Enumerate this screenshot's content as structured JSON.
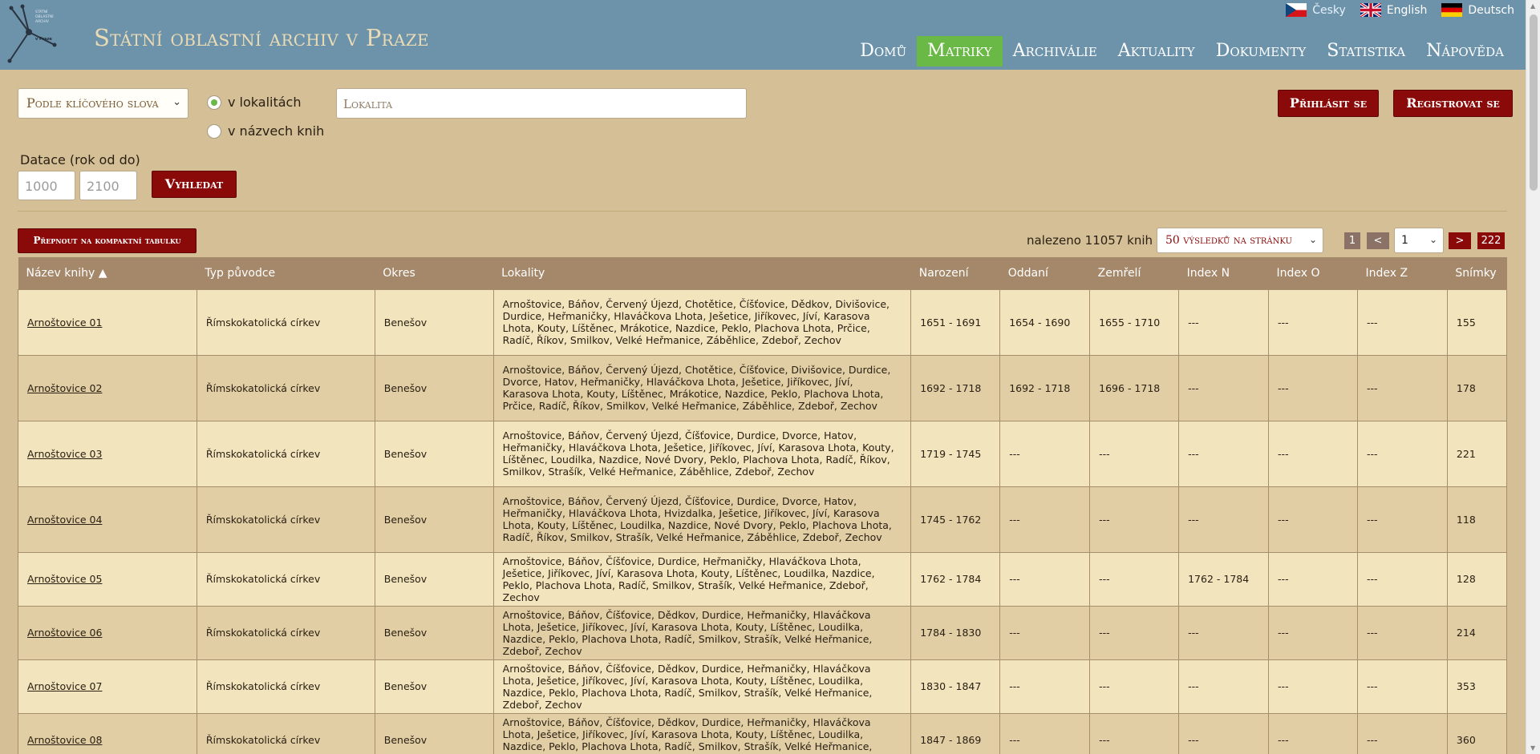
{
  "header": {
    "logo_text": [
      "STÁTNÍ",
      "OBLASTNÍ",
      "ARCHIV",
      "v Praze"
    ],
    "site_title": "Státní oblastní archiv v Praze",
    "languages": [
      {
        "label": "Česky",
        "flag": "cz-flag-icon"
      },
      {
        "label": "English",
        "flag": "uk-flag-icon"
      },
      {
        "label": "Deutsch",
        "flag": "de-flag-icon"
      }
    ],
    "nav": [
      "Domů",
      "Matriky",
      "Archiválie",
      "Aktuality",
      "Dokumenty",
      "Statistika",
      "Nápověda"
    ],
    "active_nav": "Matriky"
  },
  "search": {
    "mode_select": "Podle klíčového slova",
    "radio_locality": "v lokalitách",
    "radio_books": "v názvech knih",
    "locality_placeholder": "Lokalita",
    "login_button": "Přihlásit se",
    "register_button": "Registrovat se",
    "dating_label": "Datace (rok od do)",
    "year_from_placeholder": "1000",
    "year_to_placeholder": "2100",
    "search_button": "Vyhledat"
  },
  "results": {
    "compact_button": "Přepnout na kompaktní tabulku",
    "found_text": "nalezeno 11057 knih",
    "per_page": "50 výsledků na stránku",
    "first_page": "1",
    "prev": "<",
    "current_page": "1",
    "next": ">",
    "last_page": "222"
  },
  "table": {
    "headers": [
      "Název knihy ▲",
      "Typ původce",
      "Okres",
      "Lokality",
      "Narození",
      "Oddaní",
      "Zemřelí",
      "Index N",
      "Index O",
      "Index Z",
      "Snímky"
    ],
    "rows": [
      {
        "name": "Arnoštovice 01",
        "type": "Římskokatolická církev",
        "district": "Benešov",
        "localities": "Arnoštovice, Báňov, Červený Újezd, Chotětice, Číšťovice, Dědkov, Divišovice, Durdice, Heřmaničky, Hlaváčkova Lhota, Ješetice, Jiříkovec, Jíví, Karasova Lhota, Kouty, Líštěnec, Mrákotice, Nazdice, Peklo, Plachova Lhota, Prčice, Radíč, Říkov, Smilkov, Velké Heřmanice, Záběhlice, Zdeboř, Zechov",
        "born": "1651 - 1691",
        "married": "1654 - 1690",
        "died": "1655 - 1710",
        "idx_n": "---",
        "idx_o": "---",
        "idx_z": "---",
        "scans": "155"
      },
      {
        "name": "Arnoštovice 02",
        "type": "Římskokatolická církev",
        "district": "Benešov",
        "localities": "Arnoštovice, Báňov, Červený Újezd, Chotětice, Číšťovice, Divišovice, Durdice, Dvorce, Hatov, Heřmaničky, Hlaváčkova Lhota, Ješetice, Jiříkovec, Jíví, Karasova Lhota, Kouty, Líštěnec, Mrákotice, Nazdice, Peklo, Plachova Lhota, Prčice, Radíč, Říkov, Smilkov, Velké Heřmanice, Záběhlice, Zdeboř, Zechov",
        "born": "1692 - 1718",
        "married": "1692 - 1718",
        "died": "1696 - 1718",
        "idx_n": "---",
        "idx_o": "---",
        "idx_z": "---",
        "scans": "178"
      },
      {
        "name": "Arnoštovice 03",
        "type": "Římskokatolická církev",
        "district": "Benešov",
        "localities": "Arnoštovice, Báňov, Červený Újezd, Číšťovice, Durdice, Dvorce, Hatov, Heřmaničky, Hlaváčkova Lhota, Ješetice, Jiříkovec, Jíví, Karasova Lhota, Kouty, Líštěnec, Loudilka, Nazdice, Nové Dvory, Peklo, Plachova Lhota, Radíč, Říkov, Smilkov, Strašík, Velké Heřmanice, Záběhlice, Zdeboř, Zechov",
        "born": "1719 - 1745",
        "married": "---",
        "died": "---",
        "idx_n": "---",
        "idx_o": "---",
        "idx_z": "---",
        "scans": "221"
      },
      {
        "name": "Arnoštovice 04",
        "type": "Římskokatolická církev",
        "district": "Benešov",
        "localities": "Arnoštovice, Báňov, Červený Újezd, Číšťovice, Durdice, Dvorce, Hatov, Heřmaničky, Hlaváčkova Lhota, Hvizdalka, Ješetice, Jiříkovec, Jíví, Karasova Lhota, Kouty, Líštěnec, Loudilka, Nazdice, Nové Dvory, Peklo, Plachova Lhota, Radíč, Říkov, Smilkov, Strašík, Velké Heřmanice, Záběhlice, Zdeboř, Zechov",
        "born": "1745 - 1762",
        "married": "---",
        "died": "---",
        "idx_n": "---",
        "idx_o": "---",
        "idx_z": "---",
        "scans": "118"
      },
      {
        "name": "Arnoštovice 05",
        "type": "Římskokatolická církev",
        "district": "Benešov",
        "localities": "Arnoštovice, Báňov, Číšťovice, Durdice, Heřmaničky, Hlaváčkova Lhota, Ješetice, Jiříkovec, Jíví, Karasova Lhota, Kouty, Líštěnec, Loudilka, Nazdice, Peklo, Plachova Lhota, Radíč, Smilkov, Strašík, Velké Heřmanice, Zdeboř, Zechov",
        "born": "1762 - 1784",
        "married": "---",
        "died": "---",
        "idx_n": "1762 - 1784",
        "idx_o": "---",
        "idx_z": "---",
        "scans": "128"
      },
      {
        "name": "Arnoštovice 06",
        "type": "Římskokatolická církev",
        "district": "Benešov",
        "localities": "Arnoštovice, Báňov, Číšťovice, Dědkov, Durdice, Heřmaničky, Hlaváčkova Lhota, Ješetice, Jiříkovec, Jíví, Karasova Lhota, Kouty, Líštěnec, Loudilka, Nazdice, Peklo, Plachova Lhota, Radíč, Smilkov, Strašík, Velké Heřmanice, Zdeboř, Zechov",
        "born": "1784 - 1830",
        "married": "---",
        "died": "---",
        "idx_n": "---",
        "idx_o": "---",
        "idx_z": "---",
        "scans": "214"
      },
      {
        "name": "Arnoštovice 07",
        "type": "Římskokatolická církev",
        "district": "Benešov",
        "localities": "Arnoštovice, Báňov, Číšťovice, Dědkov, Durdice, Heřmaničky, Hlaváčkova Lhota, Ješetice, Jiříkovec, Jíví, Karasova Lhota, Kouty, Líštěnec, Loudilka, Nazdice, Peklo, Plachova Lhota, Radíč, Smilkov, Strašík, Velké Heřmanice, Zdeboř, Zechov",
        "born": "1830 - 1847",
        "married": "---",
        "died": "---",
        "idx_n": "---",
        "idx_o": "---",
        "idx_z": "---",
        "scans": "353"
      },
      {
        "name": "Arnoštovice 08",
        "type": "Římskokatolická církev",
        "district": "Benešov",
        "localities": "Arnoštovice, Báňov, Číšťovice, Dědkov, Durdice, Heřmaničky, Hlaváčkova Lhota, Ješetice, Jiříkovec, Jíví, Karasova Lhota, Kouty, Líštěnec, Loudilka, Nazdice, Peklo, Plachova Lhota, Radíč, Smilkov, Strašík, Velké Heřmanice, Zdeboř, Zechov",
        "born": "1847 - 1869",
        "married": "---",
        "died": "---",
        "idx_n": "---",
        "idx_o": "---",
        "idx_z": "---",
        "scans": "360"
      }
    ]
  },
  "colors": {
    "header_bg": "#6d93ab",
    "page_bg": "#d5bf97",
    "accent_green": "#6ab845",
    "button_red": "#8a0a0a"
  }
}
